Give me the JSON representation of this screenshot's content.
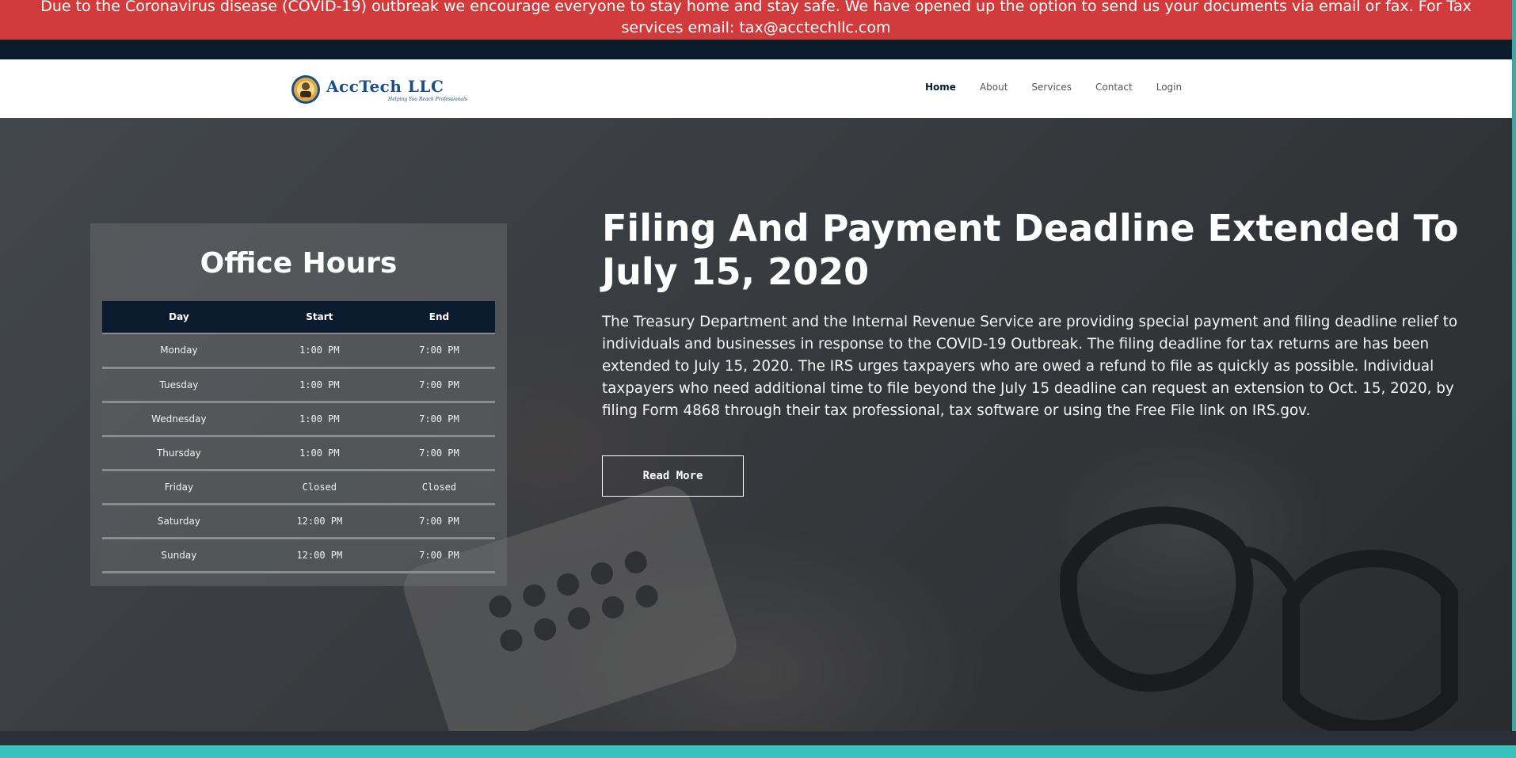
{
  "alert": {
    "text": "Due to the Coronavirus disease (COVID-19) outbreak we encourage everyone to stay home and stay safe. We have opened up the option to send us your documents via email or fax. For Tax services email: tax@acctechllc.com"
  },
  "header": {
    "logo_text": "AccTech LLC",
    "logo_tagline": "Helping You Reach Professionals",
    "nav": [
      "Home",
      "About",
      "Services",
      "Contact",
      "Login"
    ],
    "active_nav": "Home"
  },
  "office_hours": {
    "title": "Office Hours",
    "columns": [
      "Day",
      "Start",
      "End"
    ],
    "rows": [
      [
        "Monday",
        "1:00 PM",
        "7:00 PM"
      ],
      [
        "Tuesday",
        "1:00 PM",
        "7:00 PM"
      ],
      [
        "Wednesday",
        "1:00 PM",
        "7:00 PM"
      ],
      [
        "Thursday",
        "1:00 PM",
        "7:00 PM"
      ],
      [
        "Friday",
        "Closed",
        "Closed"
      ],
      [
        "Saturday",
        "12:00 PM",
        "7:00 PM"
      ],
      [
        "Sunday",
        "12:00 PM",
        "7:00 PM"
      ]
    ]
  },
  "news": {
    "title": "Filing And Payment Deadline Extended To July 15, 2020",
    "body": "The Treasury Department and the Internal Revenue Service are providing special payment and filing deadline relief to individuals and businesses in response to the COVID-19 Outbreak. The filing deadline for tax returns are has been extended to July 15, 2020. The IRS urges taxpayers who are owed a refund to file as quickly as possible. Individual taxpayers who need additional time to file beyond the July 15 deadline can request an extension to Oct. 15, 2020, by filing Form 4868 through their tax professional, tax software or using the Free File link on IRS.gov.",
    "button_label": "Read More"
  },
  "colors": {
    "alert_bg": "#d13b3b",
    "navy": "#0b1b2e",
    "teal": "#3cc0bd",
    "logo_blue": "#1a4f8a"
  }
}
